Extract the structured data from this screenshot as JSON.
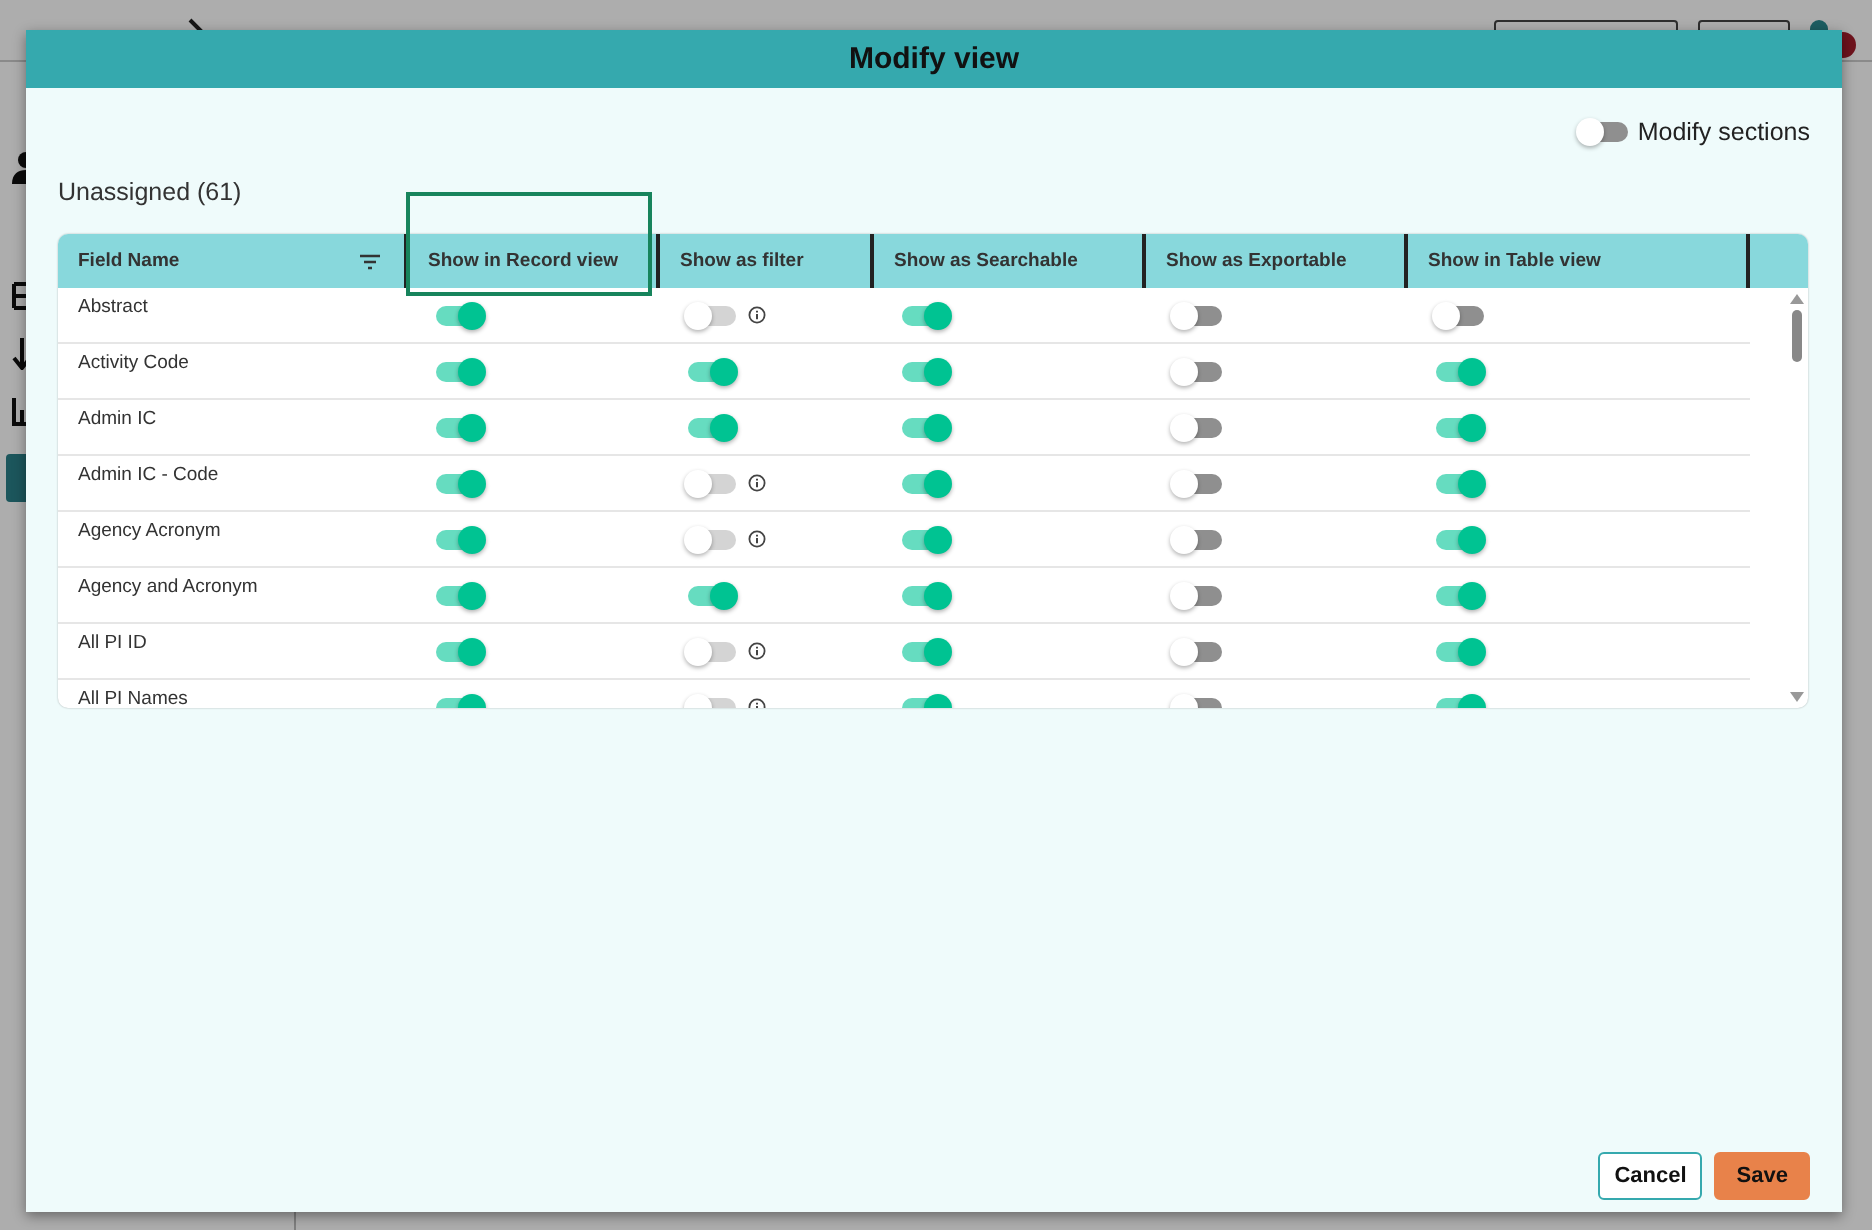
{
  "dialog": {
    "title": "Modify view",
    "modify_sections": {
      "label": "Modify sections",
      "on": false
    },
    "group_title": "Unassigned (61)",
    "columns": [
      {
        "label": "Field Name",
        "highlighted": false
      },
      {
        "label": "Show in Record view",
        "highlighted": true
      },
      {
        "label": "Show as filter",
        "highlighted": false
      },
      {
        "label": "Show as Searchable",
        "highlighted": false
      },
      {
        "label": "Show as Exportable",
        "highlighted": false
      },
      {
        "label": "Show in Table view",
        "highlighted": false
      }
    ],
    "rows": [
      {
        "name": "Abstract",
        "cells": [
          {
            "on": true,
            "disabled": false
          },
          {
            "on": false,
            "disabled": true
          },
          {
            "on": true,
            "disabled": false
          },
          {
            "on": false,
            "disabled": false
          },
          {
            "on": false,
            "disabled": false
          }
        ]
      },
      {
        "name": "Activity Code",
        "cells": [
          {
            "on": true,
            "disabled": false
          },
          {
            "on": true,
            "disabled": false
          },
          {
            "on": true,
            "disabled": false
          },
          {
            "on": false,
            "disabled": false
          },
          {
            "on": true,
            "disabled": false
          }
        ]
      },
      {
        "name": "Admin IC",
        "cells": [
          {
            "on": true,
            "disabled": false
          },
          {
            "on": true,
            "disabled": false
          },
          {
            "on": true,
            "disabled": false
          },
          {
            "on": false,
            "disabled": false
          },
          {
            "on": true,
            "disabled": false
          }
        ]
      },
      {
        "name": "Admin IC - Code",
        "cells": [
          {
            "on": true,
            "disabled": false
          },
          {
            "on": false,
            "disabled": true
          },
          {
            "on": true,
            "disabled": false
          },
          {
            "on": false,
            "disabled": false
          },
          {
            "on": true,
            "disabled": false
          }
        ]
      },
      {
        "name": "Agency Acronym",
        "cells": [
          {
            "on": true,
            "disabled": false
          },
          {
            "on": false,
            "disabled": true
          },
          {
            "on": true,
            "disabled": false
          },
          {
            "on": false,
            "disabled": false
          },
          {
            "on": true,
            "disabled": false
          }
        ]
      },
      {
        "name": "Agency and Acronym",
        "cells": [
          {
            "on": true,
            "disabled": false
          },
          {
            "on": true,
            "disabled": false
          },
          {
            "on": true,
            "disabled": false
          },
          {
            "on": false,
            "disabled": false
          },
          {
            "on": true,
            "disabled": false
          }
        ]
      },
      {
        "name": "All PI ID",
        "cells": [
          {
            "on": true,
            "disabled": false
          },
          {
            "on": false,
            "disabled": true
          },
          {
            "on": true,
            "disabled": false
          },
          {
            "on": false,
            "disabled": false
          },
          {
            "on": true,
            "disabled": false
          }
        ]
      },
      {
        "name": "All PI Names",
        "cells": [
          {
            "on": true,
            "disabled": false
          },
          {
            "on": false,
            "disabled": true
          },
          {
            "on": true,
            "disabled": false
          },
          {
            "on": false,
            "disabled": false
          },
          {
            "on": true,
            "disabled": false
          }
        ]
      }
    ],
    "actions": [
      {
        "label": "Cancel",
        "kind": "secondary"
      },
      {
        "label": "Save",
        "kind": "primary"
      }
    ]
  }
}
